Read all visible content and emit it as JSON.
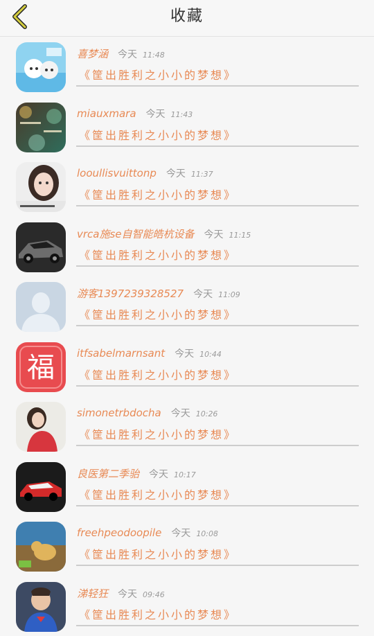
{
  "header": {
    "title": "收藏",
    "back_icon": "chevron-left-icon",
    "accent": "#c9c43a"
  },
  "colors": {
    "accent": "#e88a55",
    "muted": "#9a9a9a"
  },
  "favorites": [
    {
      "name": "喜梦涵",
      "day": "今天",
      "time": "11:48",
      "title": "《筐出胜利之小小的梦想》",
      "avatar": "sheep-cartoon"
    },
    {
      "name": "miauxmara",
      "day": "今天",
      "time": "11:43",
      "title": "《筐出胜利之小小的梦想》",
      "avatar": "bokeh-text"
    },
    {
      "name": "looullisvuittonp",
      "day": "今天",
      "time": "11:37",
      "title": "《筐出胜利之小小的梦想》",
      "avatar": "girl-portrait"
    },
    {
      "name": "vrca施se自智能皓杭设备",
      "day": "今天",
      "time": "11:15",
      "title": "《筐出胜利之小小的梦想》",
      "avatar": "sports-car"
    },
    {
      "name": "游客1397239328527",
      "day": "今天",
      "time": "11:09",
      "title": "《筐出胜利之小小的梦想》",
      "avatar": "default-user"
    },
    {
      "name": "itfsabelmarnsant",
      "day": "今天",
      "time": "10:44",
      "title": "《筐出胜利之小小的梦想》",
      "avatar": "fu-character"
    },
    {
      "name": "simonetrbdocha",
      "day": "今天",
      "time": "10:26",
      "title": "《筐出胜利之小小的梦想》",
      "avatar": "girl-red-dress"
    },
    {
      "name": "良医第二季骀",
      "day": "今天",
      "time": "10:17",
      "title": "《筐出胜利之小小的梦想》",
      "avatar": "race-car"
    },
    {
      "name": "freehpeodoopile",
      "day": "今天",
      "time": "10:08",
      "title": "《筐出胜利之小小的梦想》",
      "avatar": "cartoon-dog"
    },
    {
      "name": "涕轻狂",
      "day": "今天",
      "time": "09:46",
      "title": "《筐出胜利之小小的梦想》",
      "avatar": "boy-superman"
    }
  ]
}
